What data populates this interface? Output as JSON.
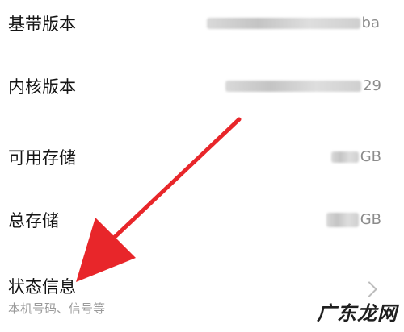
{
  "settings": {
    "items": [
      {
        "label": "基带版本",
        "value_suffix": "ba"
      },
      {
        "label": "内核版本",
        "value_suffix": "29"
      },
      {
        "label": "可用存储",
        "value_suffix": "GB"
      },
      {
        "label": "总存储",
        "value_suffix": "GB"
      },
      {
        "label": "状态信息",
        "subtitle": "本机号码、信号等"
      }
    ]
  },
  "watermark": {
    "text": "广东龙网"
  },
  "annotation": {
    "color": "#e8262a"
  },
  "icons": {
    "chevron": "chevron-right-icon",
    "arrow": "red-arrow-annotation"
  }
}
